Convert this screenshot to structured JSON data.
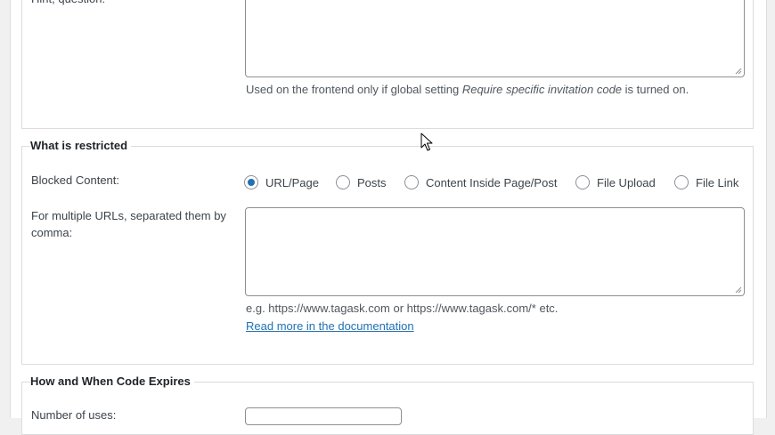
{
  "question_section": {
    "label_partial": "Hint, question:",
    "hint_prefix": "Used on the frontend only if global setting ",
    "hint_emphasis": "Require specific invitation code",
    "hint_suffix": " is turned on."
  },
  "restricted_section": {
    "legend": "What is restricted",
    "blocked_label": "Blocked Content:",
    "options": [
      {
        "label": "URL/Page",
        "checked": true
      },
      {
        "label": "Posts",
        "checked": false
      },
      {
        "label": "Content Inside Page/Post",
        "checked": false
      },
      {
        "label": "File Upload",
        "checked": false
      },
      {
        "label": "File Link",
        "checked": false
      }
    ],
    "urls_label": "For multiple URLs, separated them by comma:",
    "urls_value": "",
    "example_hint": "e.g. https://www.tagask.com or https://www.tagask.com/* etc.",
    "doc_link": "Read more in the documentation"
  },
  "expires_section": {
    "legend": "How and When Code Expires",
    "uses_label": "Number of uses:"
  },
  "colors": {
    "accent": "#2271b1",
    "border": "#dcdcde",
    "input_border": "#8c8f94"
  }
}
